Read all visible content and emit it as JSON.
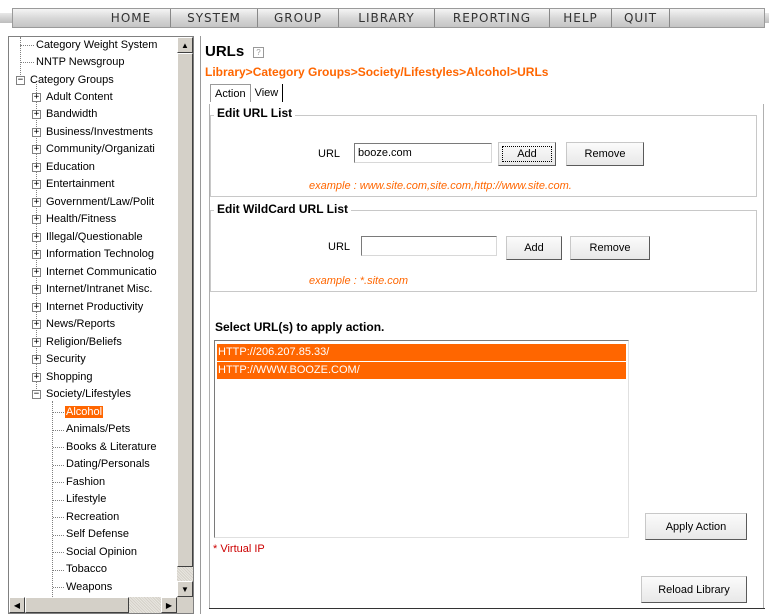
{
  "nav": {
    "items": [
      "HOME",
      "SYSTEM",
      "GROUP",
      "LIBRARY",
      "REPORTING",
      "HELP",
      "QUIT"
    ]
  },
  "tree": {
    "items": [
      {
        "label": "Category Weight System"
      },
      {
        "label": "NNTP Newsgroup"
      },
      {
        "label": "Category Groups",
        "expander": "−"
      },
      {
        "label": "Adult Content",
        "expander": "+"
      },
      {
        "label": "Bandwidth",
        "expander": "+"
      },
      {
        "label": "Business/Investments",
        "expander": "+"
      },
      {
        "label": "Community/Organizati",
        "expander": "+"
      },
      {
        "label": "Education",
        "expander": "+"
      },
      {
        "label": "Entertainment",
        "expander": "+"
      },
      {
        "label": "Government/Law/Polit",
        "expander": "+"
      },
      {
        "label": "Health/Fitness",
        "expander": "+"
      },
      {
        "label": "Illegal/Questionable",
        "expander": "+"
      },
      {
        "label": "Information Technolog",
        "expander": "+"
      },
      {
        "label": "Internet Communicatio",
        "expander": "+"
      },
      {
        "label": "Internet/Intranet Misc.",
        "expander": "+"
      },
      {
        "label": "Internet Productivity",
        "expander": "+"
      },
      {
        "label": "News/Reports",
        "expander": "+"
      },
      {
        "label": "Religion/Beliefs",
        "expander": "+"
      },
      {
        "label": "Security",
        "expander": "+"
      },
      {
        "label": "Shopping",
        "expander": "+"
      },
      {
        "label": "Society/Lifestyles",
        "expander": "−"
      },
      {
        "label": "Alcohol"
      },
      {
        "label": "Animals/Pets"
      },
      {
        "label": "Books & Literature"
      },
      {
        "label": "Dating/Personals"
      },
      {
        "label": "Fashion"
      },
      {
        "label": "Lifestyle"
      },
      {
        "label": "Recreation"
      },
      {
        "label": "Self Defense"
      },
      {
        "label": "Social Opinion"
      },
      {
        "label": "Tobacco"
      },
      {
        "label": "Weapons"
      }
    ],
    "selected": "Alcohol"
  },
  "page": {
    "title": "URLs",
    "help_glyph": "?",
    "breadcrumb": "Library>Category Groups>Society/Lifestyles>Alcohol>URLs",
    "tabs": [
      "Action",
      "View"
    ]
  },
  "edit_url": {
    "legend": "Edit URL List",
    "url_label": "URL",
    "url_value": "booze.com",
    "add_label": "Add",
    "remove_label": "Remove",
    "example": "example : www.site.com,site.com,http://www.site.com."
  },
  "edit_wildcard": {
    "legend": "Edit WildCard URL List",
    "url_label": "URL",
    "url_value": "",
    "add_label": "Add",
    "remove_label": "Remove",
    "example": "example : *.site.com"
  },
  "select": {
    "title": "Select URL(s) to apply action.",
    "urls": [
      "HTTP://206.207.85.33/",
      "HTTP://WWW.BOOZE.COM/"
    ],
    "apply_label": "Apply Action",
    "virtual_ip_note": "* Virtual IP",
    "reload_label": "Reload Library"
  },
  "colors": {
    "accent": "#ff6600",
    "note_red": "#cc0000"
  }
}
